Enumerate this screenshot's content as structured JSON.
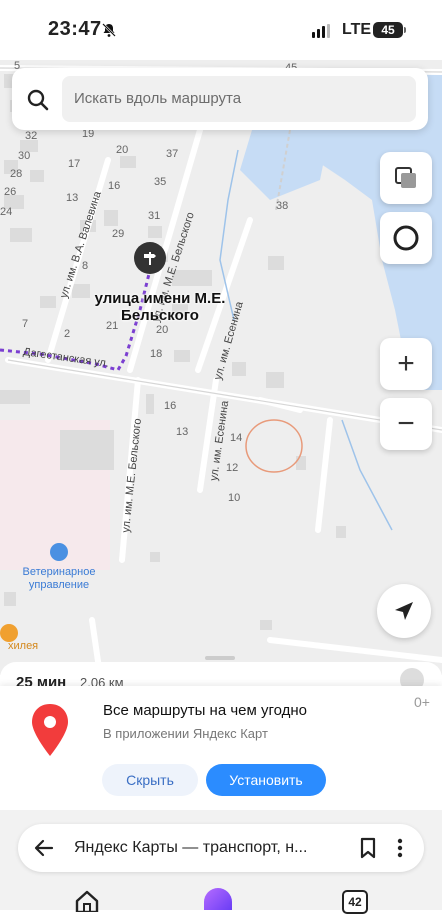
{
  "status_bar": {
    "time": "23:47",
    "network": "LTE",
    "battery": "45",
    "icons": [
      "bell-off-icon",
      "signal-icon",
      "battery-icon"
    ]
  },
  "search": {
    "placeholder": "Искать вдоль маршрута",
    "icon": "search-icon"
  },
  "map": {
    "poi_title": "улица имени М.Е. Бельского",
    "vet_label": "Ветеринарное управление",
    "poi_partial": "хилея",
    "streets": {
      "valevina": "ул. им. В.А. Валевина",
      "belskogo_top": "ул. им. М.Е. Бельского",
      "belskogo_bottom": "ул. им. М.Е. Бельского",
      "esenina_top": "ул. им. Есенина",
      "esenina_bottom": "ул. им. Есенина",
      "dagestanskaya": "Дагестанская ул."
    },
    "house_numbers": {
      "n45": "45",
      "n5": "5",
      "n32": "32",
      "n19": "19",
      "n30": "30",
      "n17": "17",
      "n20": "20",
      "n37": "37",
      "n28": "28",
      "n26": "26",
      "n16": "16",
      "n35": "35",
      "n13": "13",
      "n24": "24",
      "n31": "31",
      "n29": "29",
      "n38": "38",
      "n8": "8",
      "n7": "7",
      "n2": "2",
      "n21": "21",
      "n20b": "20",
      "n18": "18",
      "n16b": "16",
      "n13b": "13",
      "n14": "14",
      "n12": "12",
      "n10": "10"
    },
    "colors": {
      "water": "#c6dcf5",
      "route": "#7b3fd1",
      "accent": "#2b8cff"
    }
  },
  "controls": {
    "layers": "layers-icon",
    "globe": "globe-ring-icon",
    "zoom_in": "+",
    "zoom_out": "−",
    "locate": "navigation-arrow-icon"
  },
  "route_peek": {
    "time": "25 мин",
    "distance": "2,06 км"
  },
  "promo": {
    "title": "Все маршруты на чем угодно",
    "subtitle": "В приложении Яндекс Карт",
    "hide_label": "Скрыть",
    "install_label": "Установить",
    "counter": "0+"
  },
  "browser": {
    "url_title": "Яндекс Карты — транспорт, н...",
    "tabs_count": "42"
  }
}
